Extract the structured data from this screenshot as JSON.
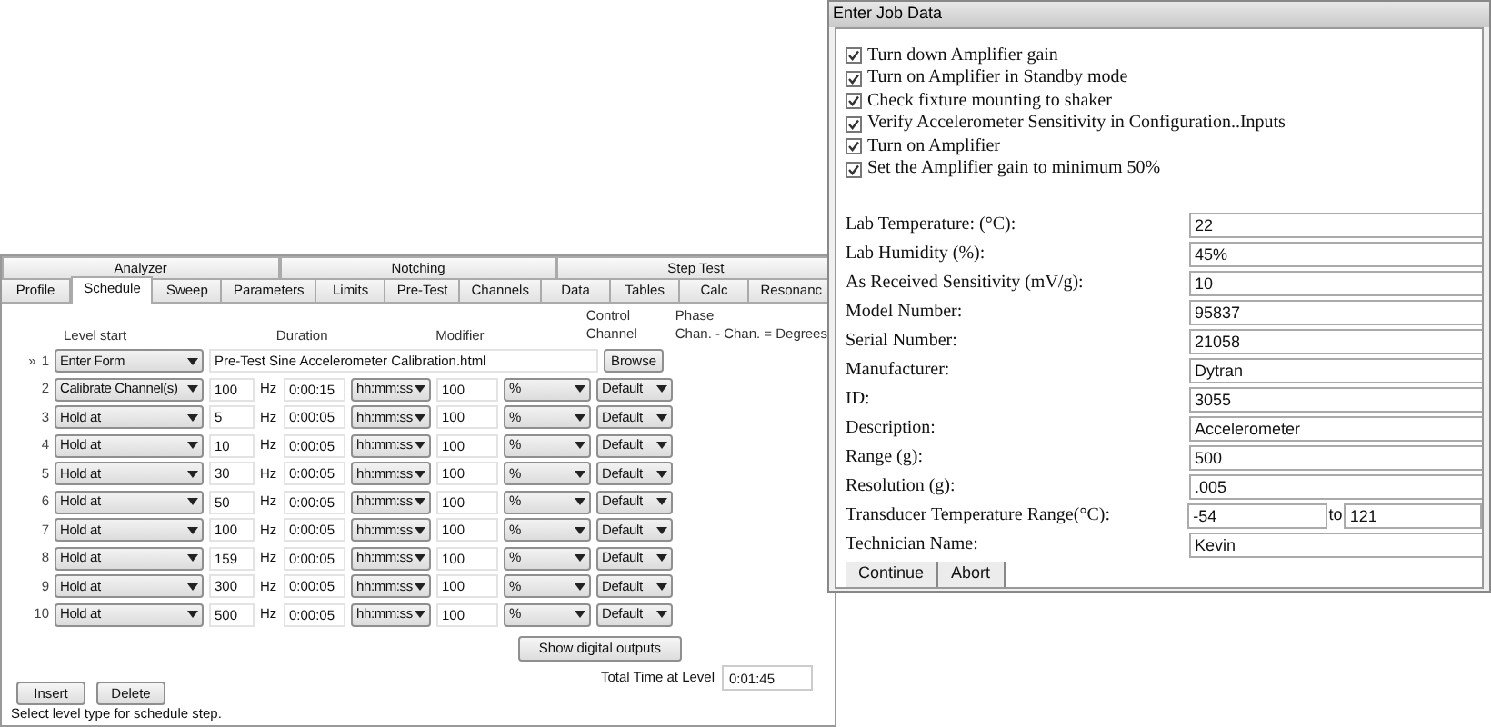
{
  "schedule_window": {
    "tab_groups": [
      {
        "label": "Analyzer"
      },
      {
        "label": "Notching"
      },
      {
        "label": "Step Test"
      }
    ],
    "tabs": [
      {
        "label": "Profile",
        "selected": false
      },
      {
        "label": "Schedule",
        "selected": true
      },
      {
        "label": "Sweep",
        "selected": false
      },
      {
        "label": "Parameters",
        "selected": false
      },
      {
        "label": "Limits",
        "selected": false
      },
      {
        "label": "Pre-Test",
        "selected": false
      },
      {
        "label": "Channels",
        "selected": false
      },
      {
        "label": "Data",
        "selected": false
      },
      {
        "label": "Tables",
        "selected": false
      },
      {
        "label": "Calc",
        "selected": false
      },
      {
        "label": "Resonanc",
        "selected": false
      }
    ],
    "headers": {
      "level_start": "Level start",
      "duration": "Duration",
      "modifier": "Modifier",
      "control_channel": "Control Channel",
      "phase": "Phase",
      "phase_formula": "Chan. - Chan. = Degrees"
    },
    "rows": [
      {
        "kind": "form",
        "marker": "»",
        "number": "1",
        "level_type": "Enter Form",
        "file": "Pre-Test Sine Accelerometer Calibration.html",
        "browse": "Browse"
      },
      {
        "kind": "step",
        "number": "2",
        "level_type": "Calibrate Channel(s)",
        "frequency": "100",
        "unit": "Hz",
        "duration": "0:00:15",
        "duration_unit": "hh:mm:ss",
        "modifier": "100",
        "modifier_unit": "%",
        "channel": "Default"
      },
      {
        "kind": "step",
        "number": "3",
        "level_type": "Hold at",
        "frequency": "5",
        "unit": "Hz",
        "duration": "0:00:05",
        "duration_unit": "hh:mm:ss",
        "modifier": "100",
        "modifier_unit": "%",
        "channel": "Default"
      },
      {
        "kind": "step",
        "number": "4",
        "level_type": "Hold at",
        "frequency": "10",
        "unit": "Hz",
        "duration": "0:00:05",
        "duration_unit": "hh:mm:ss",
        "modifier": "100",
        "modifier_unit": "%",
        "channel": "Default"
      },
      {
        "kind": "step",
        "number": "5",
        "level_type": "Hold at",
        "frequency": "30",
        "unit": "Hz",
        "duration": "0:00:05",
        "duration_unit": "hh:mm:ss",
        "modifier": "100",
        "modifier_unit": "%",
        "channel": "Default"
      },
      {
        "kind": "step",
        "number": "6",
        "level_type": "Hold at",
        "frequency": "50",
        "unit": "Hz",
        "duration": "0:00:05",
        "duration_unit": "hh:mm:ss",
        "modifier": "100",
        "modifier_unit": "%",
        "channel": "Default"
      },
      {
        "kind": "step",
        "number": "7",
        "level_type": "Hold at",
        "frequency": "100",
        "unit": "Hz",
        "duration": "0:00:05",
        "duration_unit": "hh:mm:ss",
        "modifier": "100",
        "modifier_unit": "%",
        "channel": "Default"
      },
      {
        "kind": "step",
        "number": "8",
        "level_type": "Hold at",
        "frequency": "159",
        "unit": "Hz",
        "duration": "0:00:05",
        "duration_unit": "hh:mm:ss",
        "modifier": "100",
        "modifier_unit": "%",
        "channel": "Default"
      },
      {
        "kind": "step",
        "number": "9",
        "level_type": "Hold at",
        "frequency": "300",
        "unit": "Hz",
        "duration": "0:00:05",
        "duration_unit": "hh:mm:ss",
        "modifier": "100",
        "modifier_unit": "%",
        "channel": "Default"
      },
      {
        "kind": "step",
        "number": "10",
        "level_type": "Hold at",
        "frequency": "500",
        "unit": "Hz",
        "duration": "0:00:05",
        "duration_unit": "hh:mm:ss",
        "modifier": "100",
        "modifier_unit": "%",
        "channel": "Default"
      }
    ],
    "show_outputs_button": "Show digital outputs",
    "total_label": "Total Time at Level",
    "total_value": "0:01:45",
    "buttons": [
      "Insert",
      "Delete"
    ],
    "status": "Select level type for schedule step."
  },
  "job_dialog": {
    "title": "Enter Job Data",
    "checklist": [
      {
        "label": "Turn down Amplifier gain",
        "checked": true
      },
      {
        "label": "Turn on Amplifier in Standby mode",
        "checked": true
      },
      {
        "label": "Check fixture mounting to shaker",
        "checked": true
      },
      {
        "label": "Verify Accelerometer Sensitivity in Configuration..Inputs",
        "checked": true
      },
      {
        "label": "Turn on Amplifier",
        "checked": true
      },
      {
        "label": "Set the Amplifier gain to minimum 50%",
        "checked": true
      }
    ],
    "fields": [
      {
        "kind": "single",
        "label": "Lab Temperature: (°C):",
        "value": "22"
      },
      {
        "kind": "single",
        "label": "Lab Humidity (%):",
        "value": "45%"
      },
      {
        "kind": "single",
        "label": "As Received Sensitivity (mV/g):",
        "value": "10"
      },
      {
        "kind": "single",
        "label": "Model Number:",
        "value": "95837"
      },
      {
        "kind": "single",
        "label": "Serial Number:",
        "value": "21058"
      },
      {
        "kind": "single",
        "label": "Manufacturer:",
        "value": "Dytran"
      },
      {
        "kind": "single",
        "label": "ID:",
        "value": "3055"
      },
      {
        "kind": "single",
        "label": "Description:",
        "value": "Accelerometer"
      },
      {
        "kind": "single",
        "label": "Range (g):",
        "value": "500"
      },
      {
        "kind": "single",
        "label": "Resolution (g):",
        "value": ".005"
      },
      {
        "kind": "range",
        "label": "Transducer Temperature Range(°C):",
        "value": "-54",
        "joiner": "to",
        "value_to": "121"
      },
      {
        "kind": "single",
        "label": "Technician Name:",
        "value": "Kevin"
      }
    ],
    "buttons": [
      "Continue",
      "Abort"
    ]
  }
}
